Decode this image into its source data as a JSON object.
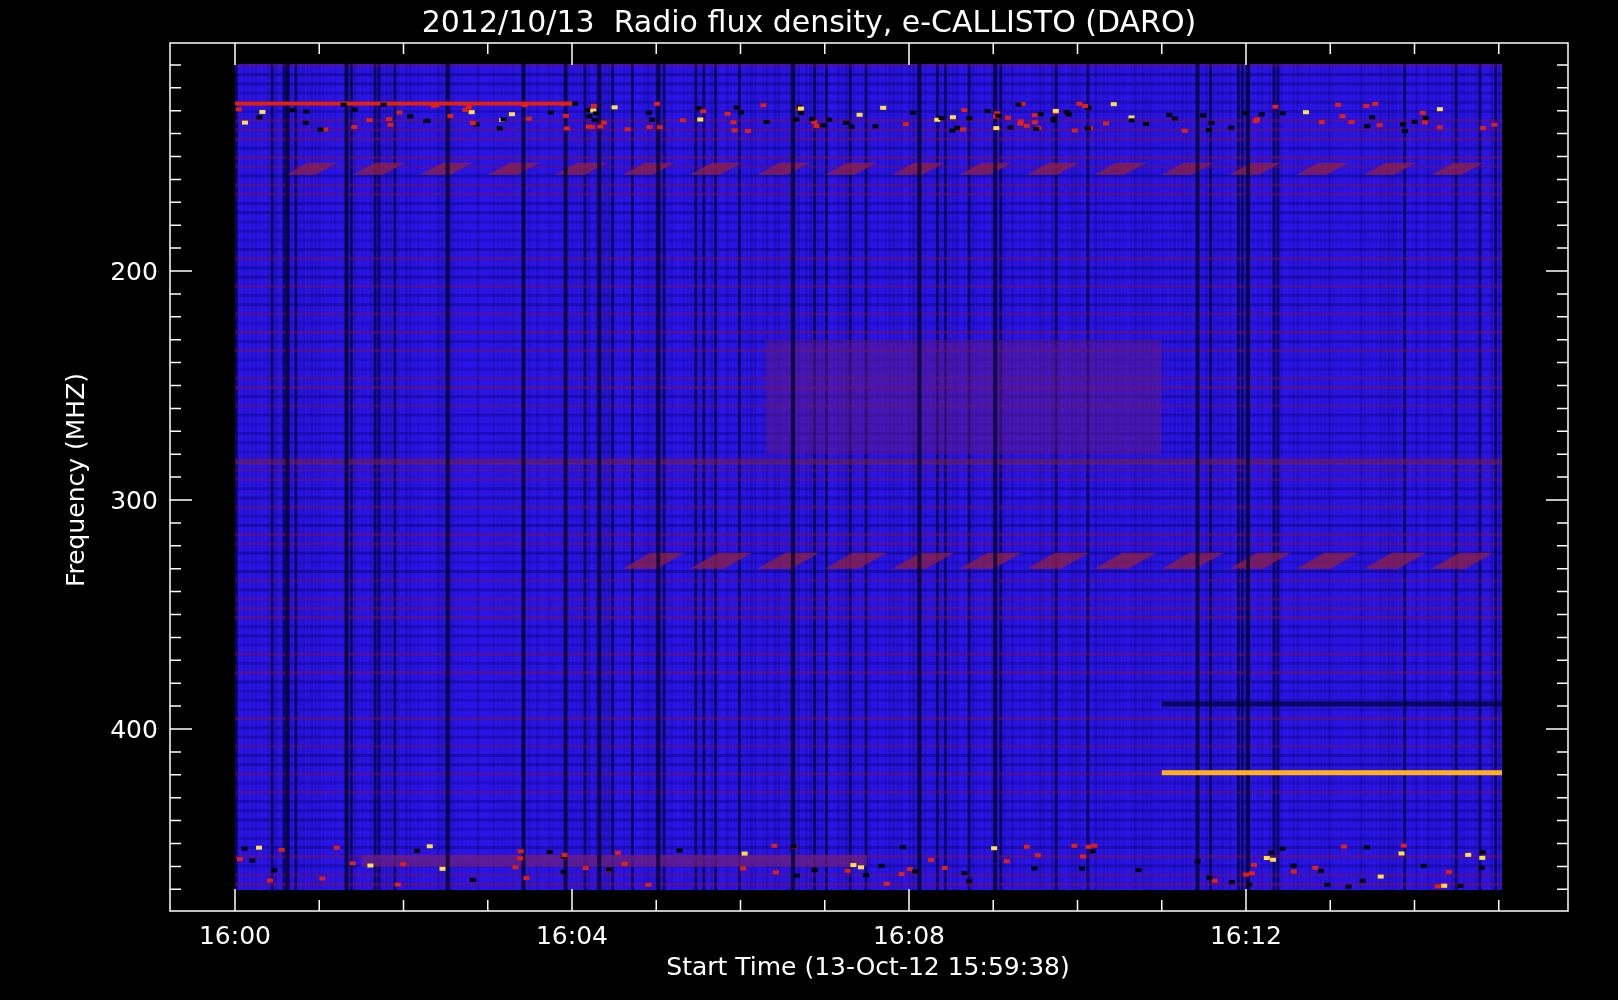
{
  "title": "2012/10/13  Radio flux density, e-CALLISTO (DARO)",
  "x_axis": {
    "label": "Start Time (13-Oct-12 15:59:38)",
    "ticks": [
      "16:00",
      "16:04",
      "16:08",
      "16:12"
    ]
  },
  "y_axis": {
    "label": "Frequency (MHZ)",
    "ticks": [
      "200",
      "300",
      "400"
    ]
  }
}
